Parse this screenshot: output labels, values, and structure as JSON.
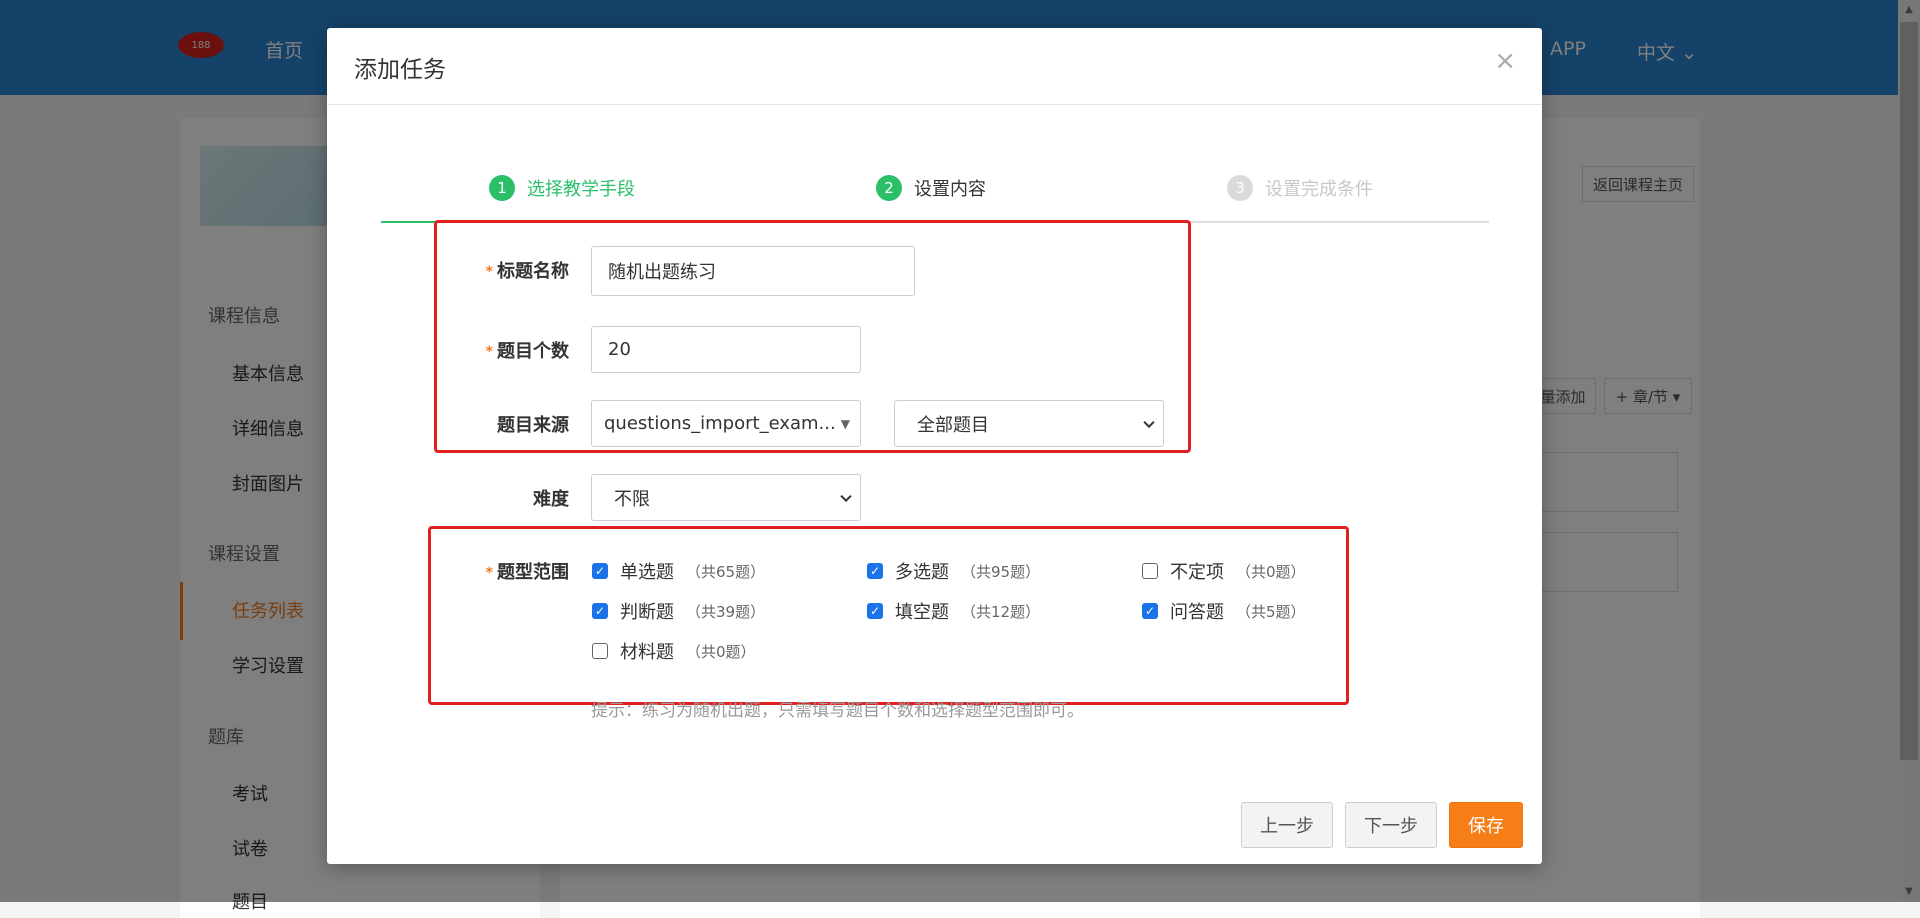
{
  "background": {
    "logo_text": "188",
    "nav": {
      "home": "首页",
      "app": "APP",
      "language": "中文"
    },
    "sidebar": {
      "sections": [
        {
          "title": "课程信息",
          "items": [
            "基本信息",
            "详细信息",
            "封面图片"
          ]
        },
        {
          "title": "课程设置",
          "items": [
            "任务列表",
            "学习设置"
          ]
        },
        {
          "title": "题库",
          "items": [
            "考试",
            "试卷",
            "题目"
          ]
        }
      ],
      "active_item": "任务列表"
    },
    "buttons": {
      "back_course": "返回课程主页",
      "batch_add": "量添加",
      "chapter": "+ 章/节 ▾"
    }
  },
  "modal": {
    "title": "添加任务",
    "close": "×",
    "steps": [
      {
        "num": "1",
        "label": "选择教学手段",
        "state": "done"
      },
      {
        "num": "2",
        "label": "设置内容",
        "state": "current"
      },
      {
        "num": "3",
        "label": "设置完成条件",
        "state": "todo"
      }
    ],
    "form": {
      "title_name": {
        "label": "标题名称",
        "required": "*",
        "value": "随机出题练习"
      },
      "question_count": {
        "label": "题目个数",
        "required": "*",
        "value": "20"
      },
      "question_source": {
        "label": "题目来源",
        "bank_value": "questions_import_exam...",
        "scope_value": "全部题目"
      },
      "difficulty": {
        "label": "难度",
        "value": "不限"
      },
      "type_range": {
        "label": "题型范围",
        "required": "*",
        "options": [
          {
            "label": "单选题",
            "count": "（共65题）",
            "checked": true
          },
          {
            "label": "多选题",
            "count": "（共95题）",
            "checked": true
          },
          {
            "label": "不定项",
            "count": "（共0题）",
            "checked": false
          },
          {
            "label": "判断题",
            "count": "（共39题）",
            "checked": true
          },
          {
            "label": "填空题",
            "count": "（共12题）",
            "checked": true
          },
          {
            "label": "问答题",
            "count": "（共5题）",
            "checked": true
          },
          {
            "label": "材料题",
            "count": "（共0题）",
            "checked": false
          }
        ]
      },
      "hint": "提示：练习为随机出题，只需填写题目个数和选择题型范围即可。"
    },
    "footer": {
      "prev": "上一步",
      "next": "下一步",
      "save": "保存"
    }
  },
  "colors": {
    "accent_green": "#2bbf6a",
    "save_orange": "#f67e17",
    "annotation_red": "#e02020",
    "header_blue": "#2b84d1",
    "checkbox_blue": "#1a73e8"
  }
}
